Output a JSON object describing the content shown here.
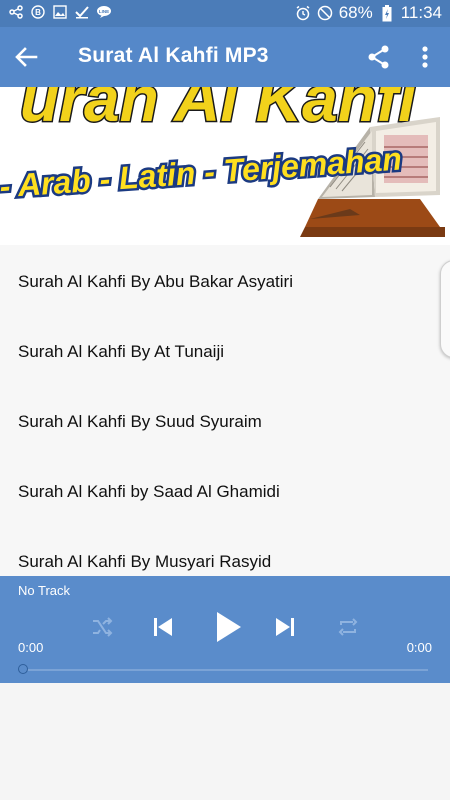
{
  "status_bar": {
    "battery": "68%",
    "time": "11:34",
    "icons": [
      "share-icon",
      "b-badge-icon",
      "image-icon",
      "check-icon",
      "line-icon",
      "alarm-icon",
      "dnd-icon",
      "battery-icon"
    ]
  },
  "app_bar": {
    "title": "Surat Al Kahfi MP3",
    "icons": [
      "back-arrow-icon",
      "share-icon",
      "more-vert-icon"
    ]
  },
  "banner": {
    "headline": "urah Al Kahfi",
    "subtitle": "- Arab - Latin - Terjemahan"
  },
  "tracks": [
    "Surah Al Kahfi By Abu Bakar Asyatiri",
    "Surah Al Kahfi By At Tunaiji",
    "Surah Al Kahfi By Suud Syuraim",
    "Surah Al Kahfi by Saad Al Ghamidi",
    "Surah Al Kahfi By Musyari Rasyid"
  ],
  "player": {
    "track_label": "No Track",
    "time_elapsed": "0:00",
    "time_total": "0:00",
    "progress": 0
  }
}
